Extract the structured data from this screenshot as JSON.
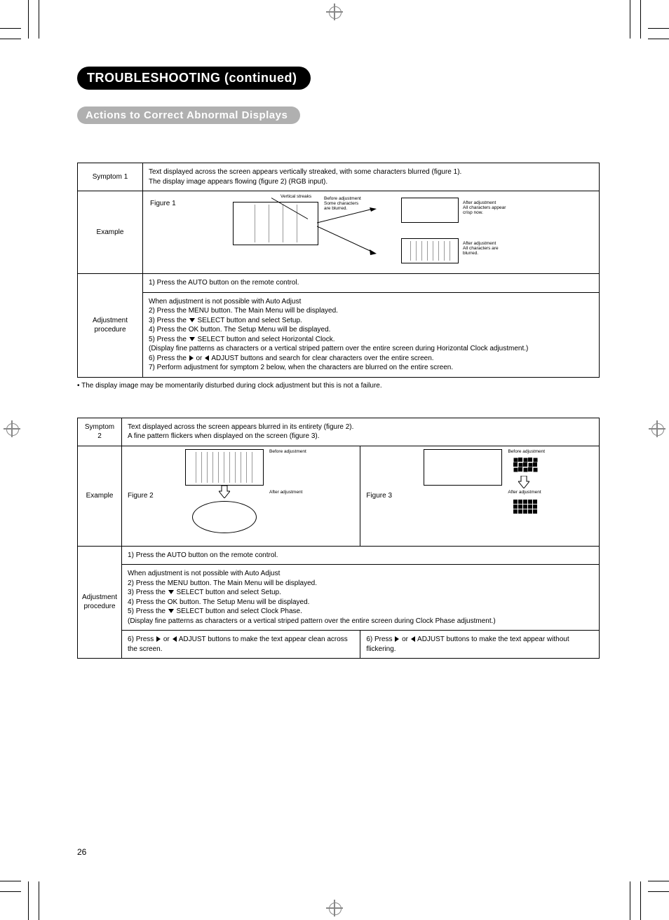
{
  "page_number": "26",
  "headings": {
    "main": "TROUBLESHOOTING (continued)",
    "sub": "Actions to Correct Abnormal Displays"
  },
  "icons": {
    "down": "▼",
    "right": "▶",
    "left": "◀"
  },
  "table1": {
    "row_symptom_label": "Symptom 1",
    "row_symptom_text_a": "Text displayed across the screen appears vertically streaked, with some characters blurred (figure 1).",
    "row_symptom_text_b": "The display image appears flowing (figure 2) (RGB input).",
    "row_example_label": "Example",
    "fig1_label": "Figure 1",
    "fig1_vertical_streaks": "Vertical streaks",
    "fig1_before": "Before adjustment\nSome characters\nare blurred.",
    "fig1_after_ok": "After adjustment\nAll characters appear\ncrisp now.",
    "fig1_after_bad": "After adjustment\nAll characters are\nblurred.",
    "row_adj_label": "Adjustment procedure",
    "adj_step1": "1) Press the AUTO button on the remote control.",
    "adj_intro": "When adjustment is not possible with Auto Adjust",
    "adj_step2": "2) Press the MENU button. The Main Menu will be displayed.",
    "adj_step3_a": "3) Press the ",
    "adj_step3_b": " SELECT button and select Setup.",
    "adj_step4": "4) Press the OK button. The Setup Menu will be displayed.",
    "adj_step5_a": "5) Press the ",
    "adj_step5_b": " SELECT button and select Horizontal Clock.",
    "adj_note": "(Display fine patterns as characters or a vertical striped pattern over the entire screen during Horizontal Clock adjustment.)",
    "adj_step6_a": "6) Press the ",
    "adj_step6_b": " or ",
    "adj_step6_c": " ADJUST buttons and search for clear characters over the entire screen.",
    "adj_step7": "7) Perform adjustment for symptom 2 below, when the characters are blurred on the entire screen."
  },
  "note1": "• The display image may be momentarily disturbed during clock adjustment but this is not a failure.",
  "table2": {
    "row_symptom_label": "Symptom 2",
    "row_symptom_text_a": "Text displayed across the screen appears blurred in its entirety (figure 2).",
    "row_symptom_text_b": "A fine pattern flickers when displayed on the screen (figure 3).",
    "row_example_label": "Example",
    "fig2_label": "Figure 2",
    "fig2_before": "Before adjustment",
    "fig2_after": "After adjustment",
    "fig3_label": "Figure 3",
    "fig3_before": "Before adjustment",
    "fig3_after": "After adjustment",
    "row_adj_label": "Adjustment procedure",
    "adj_step1": "1) Press the AUTO button on the remote control.",
    "adj_intro": "When adjustment is not possible with Auto Adjust",
    "adj_step2": "2) Press the MENU button. The Main Menu will be displayed.",
    "adj_step3_a": "3) Press the ",
    "adj_step3_b": " SELECT button and select Setup.",
    "adj_step4": "4) Press the OK button. The Setup Menu will be displayed.",
    "adj_step5_a": "5) Press the ",
    "adj_step5_b": " SELECT button and select Clock Phase.",
    "adj_note": "(Display fine patterns as characters or a vertical striped pattern over the entire screen during Clock Phase adjustment.)",
    "adj_step6L_a": "6) Press ",
    "adj_step6L_b": " or ",
    "adj_step6L_c": " ADJUST buttons to make the text appear clean across the screen.",
    "adj_step6R_a": "6) Press ",
    "adj_step6R_b": " or ",
    "adj_step6R_c": " ADJUST buttons to make the text appear without flickering."
  }
}
